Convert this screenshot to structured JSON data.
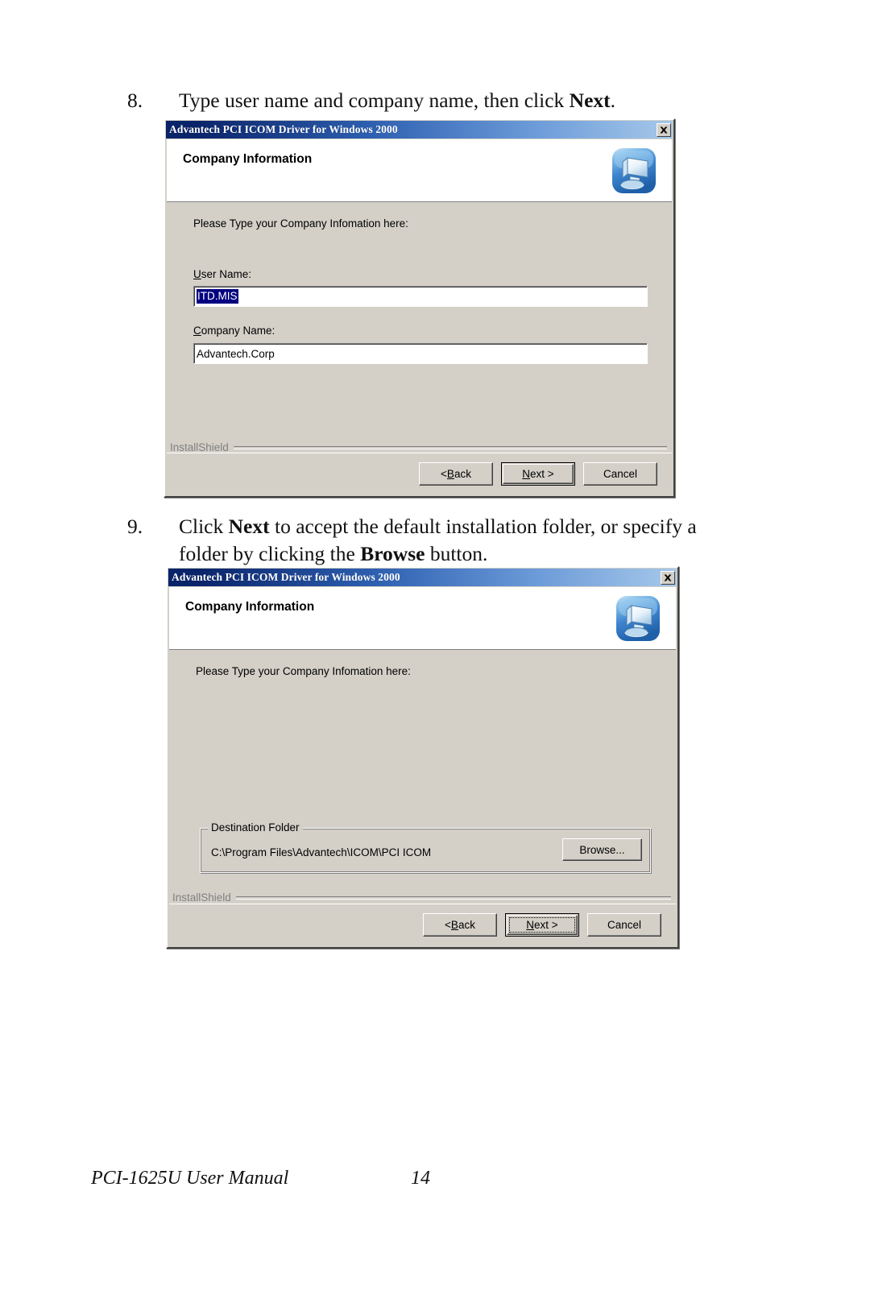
{
  "document": {
    "footer": {
      "manual_title": "PCI-1625U User Manual",
      "page_number": "14"
    }
  },
  "steps": [
    {
      "number": "8.",
      "text_before": "Type user name and company name, then click ",
      "bold": "Next",
      "text_after": "."
    },
    {
      "number": "9.",
      "text_1": "Click ",
      "bold_1": "Next",
      "text_2": " to accept the default installation folder, or specify a folder by clicking the ",
      "bold_2": "Browse",
      "text_3": " button."
    }
  ],
  "dialog1": {
    "titlebar": {
      "title": "Advantech PCI ICOM Driver for Windows 2000",
      "close_label": "x"
    },
    "header_title": "Company Information",
    "icon_name": "setup-computer-icon",
    "prompt": "Please Type your Company Infomation here:",
    "user_name_label": "User Name:",
    "user_name_value": "ITD.MIS",
    "company_name_label": "Company Name:",
    "company_name_value": "Advantech.Corp",
    "installshield_label": "InstallShield",
    "buttons": {
      "back": "< Back",
      "next": "Next >",
      "cancel": "Cancel"
    }
  },
  "dialog2": {
    "titlebar": {
      "title": "Advantech PCI ICOM Driver for Windows 2000",
      "close_label": "x"
    },
    "header_title": "Company Information",
    "icon_name": "setup-computer-icon",
    "prompt": "Please Type your Company Infomation here:",
    "destination_group_label": "Destination Folder",
    "destination_path": "C:\\Program Files\\Advantech\\ICOM\\PCI ICOM",
    "browse_label": "Browse...",
    "installshield_label": "InstallShield",
    "buttons": {
      "back": "< Back",
      "next": "Next >",
      "cancel": "Cancel"
    }
  },
  "colors": {
    "dialog_face": "#d4d0c8",
    "titlebar_start": "#0a246a",
    "titlebar_end": "#a6c8ea",
    "selection": "#000080",
    "icon_blue": "#3a7fd5"
  }
}
